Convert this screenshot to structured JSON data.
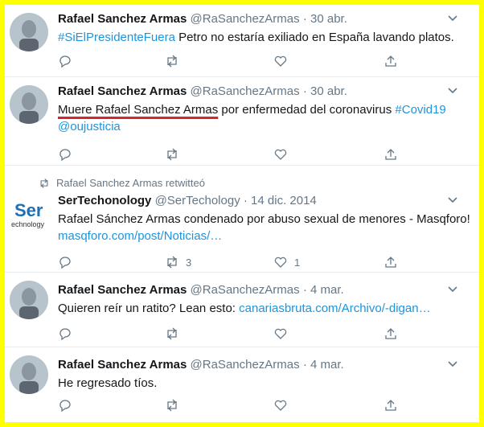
{
  "tweets": [
    {
      "name": "Rafael Sanchez Armas",
      "handle": "@RaSanchezArmas",
      "sep": "·",
      "date": "30 abr.",
      "text_parts": {
        "hashtag": "#SiElPresidenteFuera",
        "rest": " Petro no estaría exiliado en España lavando platos."
      },
      "reply_count": "",
      "retweet_count": "",
      "like_count": ""
    },
    {
      "name": "Rafael Sanchez Armas",
      "handle": "@RaSanchezArmas",
      "sep": "·",
      "date": "30 abr.",
      "text_parts": {
        "underlined": "Muere Rafael Sanchez Armas",
        "mid": " por enfermedad del coronavirus ",
        "hashtag": "#Covid19",
        "mention": "@oujusticia"
      },
      "reply_count": "",
      "retweet_count": "",
      "like_count": ""
    },
    {
      "retweet_label": "Rafael Sanchez Armas retwitteó",
      "name": "SerTechonology",
      "handle": "@SerTechology",
      "sep": "·",
      "date": "14 dic. 2014",
      "text_parts": {
        "line1": "Rafael Sánchez Armas condenado por abuso sexual de menores - Masqforo!",
        "link": "masqforo.com/post/Noticias/…"
      },
      "reply_count": "",
      "retweet_count": "3",
      "like_count": "1",
      "logo": {
        "top": "Ser",
        "bottom": "echnology"
      }
    },
    {
      "name": "Rafael Sanchez Armas",
      "handle": "@RaSanchezArmas",
      "sep": "·",
      "date": "4 mar.",
      "text_parts": {
        "rest": "Quieren reír un ratito? Lean esto: ",
        "link": "canariasbruta.com/Archivo/-digan…"
      },
      "reply_count": "",
      "retweet_count": "",
      "like_count": ""
    },
    {
      "name": "Rafael Sanchez Armas",
      "handle": "@RaSanchezArmas",
      "sep": "·",
      "date": "4 mar.",
      "text_parts": {
        "rest": "He regresado tíos."
      },
      "reply_count": "",
      "retweet_count": "",
      "like_count": ""
    }
  ],
  "colors": {
    "frame": "#ffff00",
    "link": "#1b95e0",
    "underline": "#d62730",
    "muted": "#657786"
  },
  "icons": [
    "reply-icon",
    "retweet-icon",
    "like-icon",
    "share-icon",
    "chevron-down-icon"
  ]
}
